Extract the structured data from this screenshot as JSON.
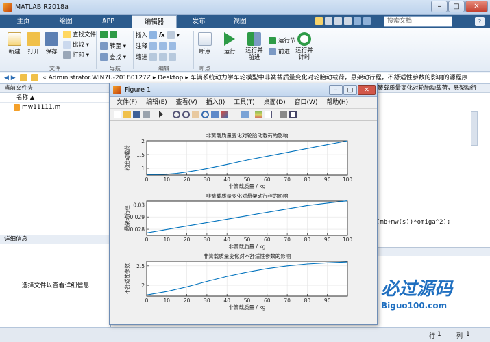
{
  "window": {
    "title": "MATLAB R2018a",
    "min": "–",
    "max": "□",
    "close": "✕"
  },
  "tabs": [
    "主页",
    "绘图",
    "APP",
    "编辑器",
    "发布",
    "视图"
  ],
  "search_placeholder": "搜索文档",
  "ribbon": {
    "file": {
      "new": "新建",
      "open": "打开",
      "save": "保存",
      "find_files": "查找文件",
      "compare": "比较",
      "print": "打印",
      "group": "文件"
    },
    "navigate": {
      "goto": "转至",
      "find": "查找",
      "group": "导航"
    },
    "edit": {
      "insert": "插入",
      "comment": "注释",
      "indent": "缩进",
      "group": "编辑"
    },
    "breakpoints": {
      "label": "断点",
      "group": "断点"
    },
    "run": {
      "run": "运行",
      "run_advance": "运行并\n前进",
      "run_section": "运行节",
      "advance": "前进",
      "run_time": "运行并\n计时",
      "group": "运行"
    }
  },
  "address": {
    "path": [
      "Administrator.WIN7U-20180127Z",
      "Desktop",
      "车辆系统动力学车轮模型中非簧载质量变化对轮胎动载荷，悬架动行程，不舒适性参数的影响的源程序"
    ]
  },
  "current_folder": {
    "title": "当前文件夹",
    "column": "名称 ▲",
    "files": [
      "mw11111.m"
    ]
  },
  "details": {
    "title": "详细信息",
    "message": "选择文件以查看详细信息"
  },
  "editor_bg": {
    "overflow_title": "簧载质量变化对轮胎动载荷，悬架动行",
    "code_fragment": "(mb+mw(s))*omiga^2);"
  },
  "status": {
    "line_label": "行",
    "line": "1",
    "col_label": "列",
    "col": "1"
  },
  "figure": {
    "title": "Figure 1",
    "menus": [
      "文件(F)",
      "编辑(E)",
      "查看(V)",
      "插入(I)",
      "工具(T)",
      "桌面(D)",
      "窗口(W)",
      "帮助(H)"
    ]
  },
  "chart_data": [
    {
      "type": "line",
      "title": "非簧载质量变化对轮胎动载荷的影响",
      "xlabel": "非簧载质量 / kg",
      "ylabel": "轮胎动载荷",
      "xlim": [
        0,
        100
      ],
      "ylim": [
        0.75,
        2
      ],
      "xticks": [
        0,
        10,
        20,
        30,
        40,
        50,
        60,
        70,
        80,
        90,
        100
      ],
      "yticks": [
        1,
        1.5,
        2
      ],
      "grid": true,
      "x": [
        0,
        5,
        10,
        15,
        20,
        25,
        30,
        40,
        50,
        60,
        70,
        80,
        90,
        100
      ],
      "y": [
        0.77,
        0.77,
        0.78,
        0.81,
        0.86,
        0.92,
        0.99,
        1.14,
        1.3,
        1.44,
        1.58,
        1.72,
        1.86,
        2.0
      ]
    },
    {
      "type": "line",
      "title": "非簧载质量变化对悬架动行程的影响",
      "xlabel": "非簧载质量 / kg",
      "ylabel": "悬架动行程",
      "xlim": [
        0,
        100
      ],
      "ylim": [
        0.0275,
        0.0303
      ],
      "xticks": [
        0,
        10,
        20,
        30,
        40,
        50,
        60,
        70,
        80,
        90,
        100
      ],
      "yticks": [
        0.028,
        0.029,
        0.03
      ],
      "ytick_labels": [
        "0.028",
        "0.029",
        "0.03"
      ],
      "grid": true,
      "x": [
        0,
        10,
        20,
        30,
        40,
        50,
        60,
        70,
        80,
        90,
        100
      ],
      "y": [
        0.0277,
        0.02798,
        0.02826,
        0.02854,
        0.02882,
        0.0291,
        0.02938,
        0.02966,
        0.02994,
        0.03014,
        0.03032
      ]
    },
    {
      "type": "line",
      "title": "非簧载质量变化对不舒适性参数的影响",
      "xlabel": "非簧载质量 / kg",
      "ylabel": "不舒适性参数",
      "xlim": [
        0,
        100
      ],
      "ylim": [
        1.72,
        2.62
      ],
      "xticks": [
        0,
        10,
        20,
        30,
        40,
        50,
        60,
        70,
        80,
        90,
        100
      ],
      "xtick_labels_shown": [
        "0",
        "10",
        "20",
        "30",
        "40",
        "50",
        "60",
        "70",
        "80",
        "90"
      ],
      "yticks": [
        2,
        2.5
      ],
      "grid": true,
      "x": [
        0,
        10,
        20,
        30,
        40,
        50,
        60,
        70,
        80,
        90,
        100
      ],
      "y": [
        1.75,
        1.84,
        1.96,
        2.1,
        2.23,
        2.34,
        2.43,
        2.5,
        2.55,
        2.58,
        2.6
      ]
    }
  ],
  "watermark": {
    "text": "必过源码",
    "url": "Biguo100.com"
  }
}
